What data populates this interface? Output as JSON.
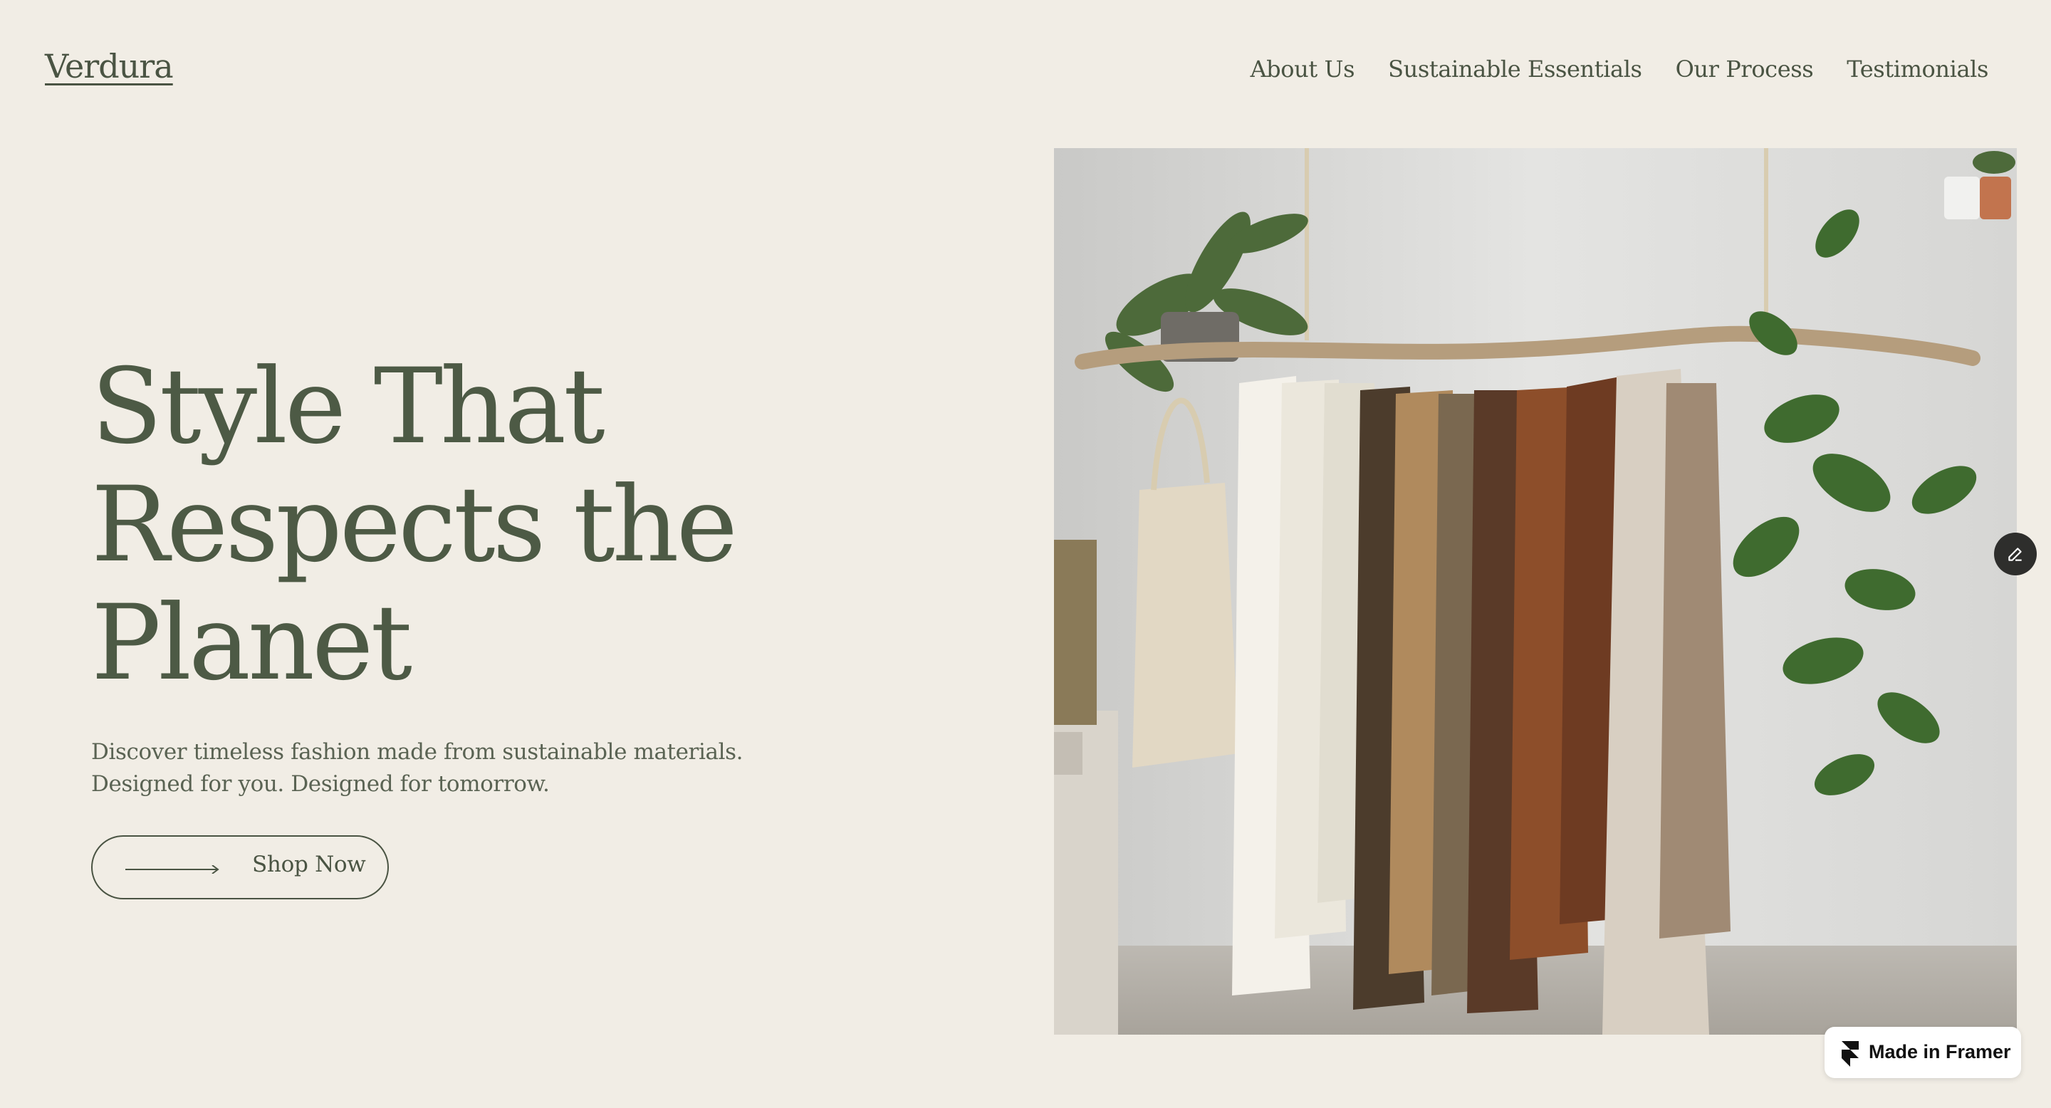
{
  "header": {
    "logo": "Verdura",
    "nav": [
      {
        "label": "About Us"
      },
      {
        "label": "Sustainable Essentials"
      },
      {
        "label": "Our Process"
      },
      {
        "label": "Testimonials"
      }
    ]
  },
  "hero": {
    "title_lines": [
      "Style That",
      "Respects the",
      "Planet"
    ],
    "subtitle_lines": [
      "Discover timeless fashion made from sustainable materials.",
      "Designed for you. Designed for tomorrow."
    ],
    "cta_label": "Shop Now",
    "cta_icon": "arrow-right-icon",
    "image_icon": "clothing-rack-photo"
  },
  "overlay": {
    "edit_icon": "pencil-icon",
    "badge_icon": "framer-logo-icon",
    "badge_label": "Made in Framer"
  },
  "colors": {
    "background": "#f1ede5",
    "primary_text": "#4d5a45",
    "badge_bg": "#ffffff"
  }
}
